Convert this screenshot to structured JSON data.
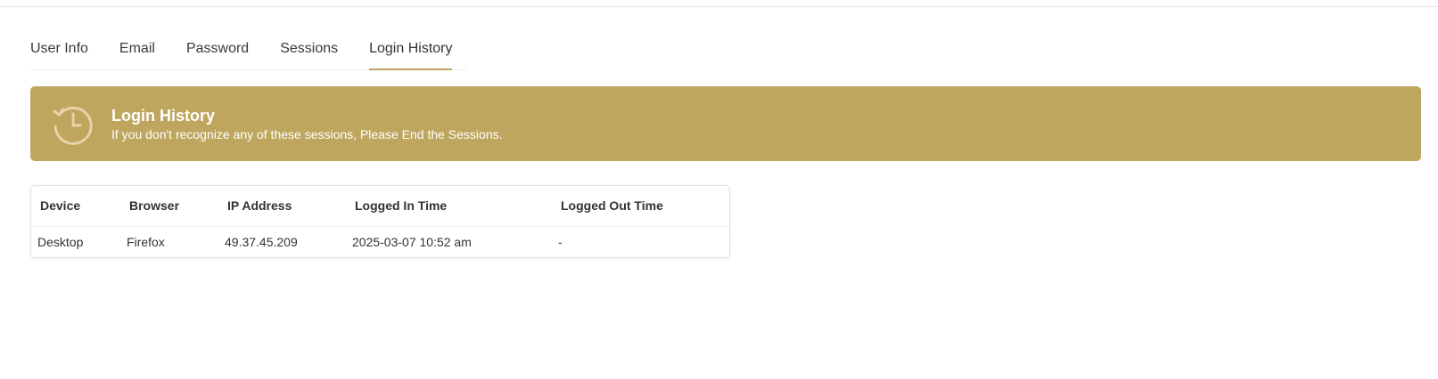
{
  "tabs": [
    {
      "label": "User Info",
      "active": false
    },
    {
      "label": "Email",
      "active": false
    },
    {
      "label": "Password",
      "active": false
    },
    {
      "label": "Sessions",
      "active": false
    },
    {
      "label": "Login History",
      "active": true
    }
  ],
  "banner": {
    "icon": "history-clock-icon",
    "title": "Login History",
    "subtitle": "If you don't recognize any of these sessions, Please End the Sessions."
  },
  "table": {
    "headers": [
      "Device",
      "Browser",
      "IP Address",
      "Logged In Time",
      "Logged Out Time"
    ],
    "rows": [
      [
        "Desktop",
        "Firefox",
        "49.37.45.209",
        "2025-03-07 10:52 am",
        "-"
      ]
    ]
  },
  "colors": {
    "accent": "#bea65e",
    "icon": "#e7d3ad"
  }
}
